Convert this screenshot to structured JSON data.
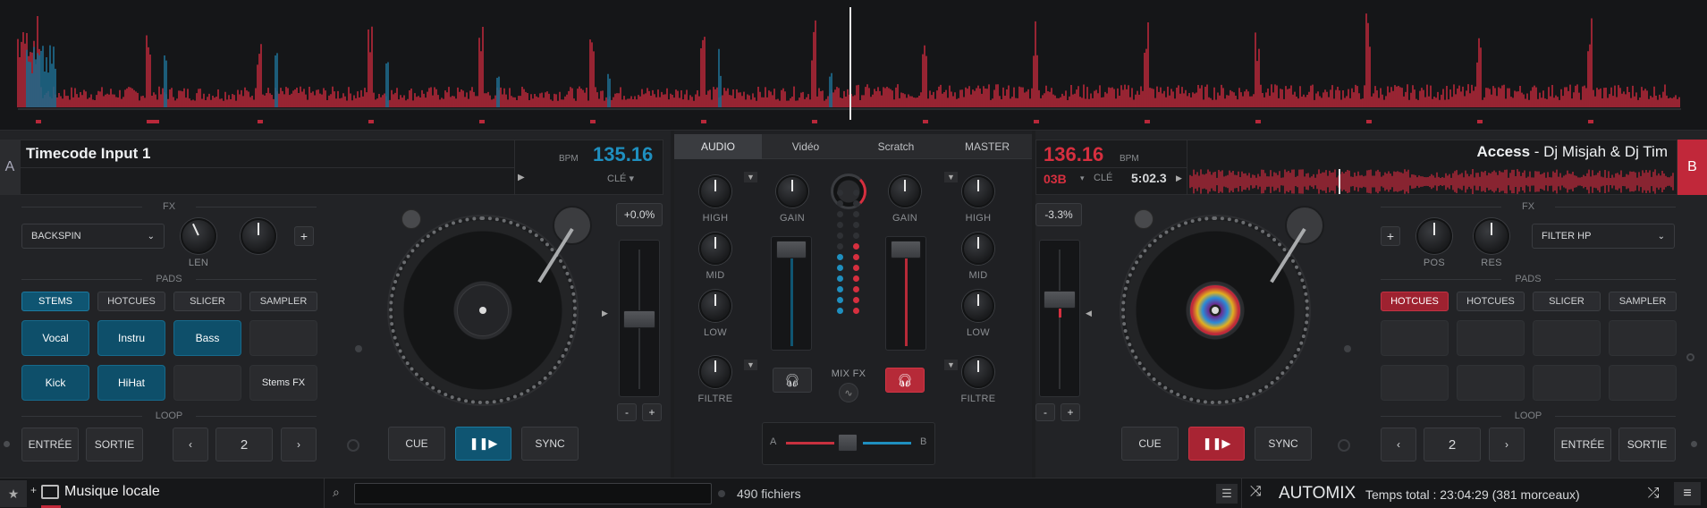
{
  "deck_a": {
    "letter": "A",
    "title": "Timecode Input 1",
    "bpm_label": "BPM",
    "bpm": "135.16",
    "key_label": "CLÉ ▾",
    "pitch": "+0.0%",
    "fx_label": "FX",
    "fx_select": "BACKSPIN",
    "len_label": "LEN",
    "pads_label": "PADS",
    "pad_tabs": [
      "STEMS",
      "HOTCUES",
      "SLICER",
      "SAMPLER"
    ],
    "pads": [
      "Vocal",
      "Instru",
      "Bass",
      "",
      "Kick",
      "HiHat",
      "",
      "Stems FX"
    ],
    "loop_label": "LOOP",
    "entree": "ENTRÉE",
    "sortie": "SORTIE",
    "loop_value": "2",
    "cue": "CUE",
    "sync": "SYNC",
    "minus": "-",
    "plus": "+"
  },
  "deck_b": {
    "letter": "B",
    "bpm": "136.16",
    "bpm_label": "BPM",
    "key": "03B",
    "key_label": "CLÉ",
    "time": "5:02.3",
    "title_bold": "Access",
    "title_rest": " - Dj Misjah & Dj Tim",
    "pitch": "-3.3%",
    "fx_label": "FX",
    "fx_select": "FILTER HP",
    "pos_label": "POS",
    "res_label": "RES",
    "pads_label": "PADS",
    "pad_tabs": [
      "HOTCUES",
      "HOTCUES",
      "SLICER",
      "SAMPLER"
    ],
    "loop_label": "LOOP",
    "entree": "ENTRÉE",
    "sortie": "SORTIE",
    "loop_value": "2",
    "cue": "CUE",
    "sync": "SYNC",
    "minus": "-",
    "plus": "+"
  },
  "mixer": {
    "tabs": [
      "AUDIO",
      "Vidéo",
      "Scratch",
      "MASTER"
    ],
    "left_eq": [
      "HIGH",
      "MID",
      "LOW",
      "FILTRE"
    ],
    "right_eq": [
      "HIGH",
      "MID",
      "LOW",
      "FILTRE"
    ],
    "gain_left": "GAIN",
    "gain_right": "GAIN",
    "mix_fx": "MIX FX",
    "cross_a": "A",
    "cross_b": "B"
  },
  "browser": {
    "folder": "Musique locale",
    "search_placeholder": "",
    "file_count": "490 fichiers",
    "automix": "AUTOMIX",
    "total": "Temps total : 23:04:29 (381 morceaux)"
  },
  "colors": {
    "deck_a_accent": "#1f8fbf",
    "deck_b_accent": "#d62f3f"
  }
}
